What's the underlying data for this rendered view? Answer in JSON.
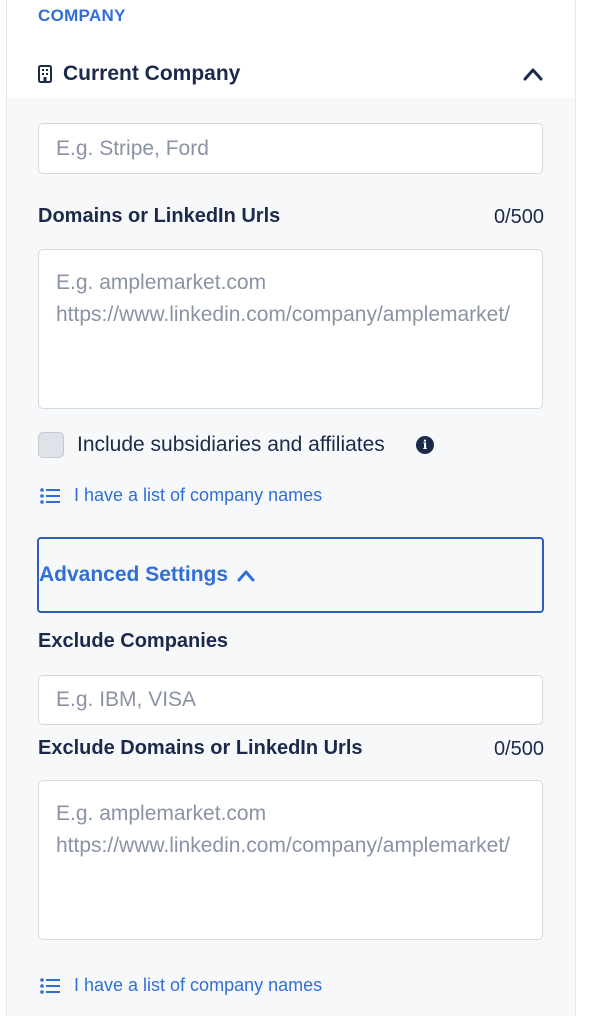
{
  "section": {
    "heading": "COMPANY"
  },
  "current_company": {
    "title": "Current Company",
    "icon": "building-icon",
    "collapse_icon": "chevron-up-icon",
    "input_placeholder": "E.g. Stripe, Ford"
  },
  "domains": {
    "label": "Domains or LinkedIn Urls",
    "counter": "0/500",
    "placeholder": "E.g. amplemarket.com\nhttps://www.linkedin.com/company/amplemarket/"
  },
  "subsidiaries": {
    "checked": false,
    "label": "Include subsidiaries and affiliates",
    "icon": "info-icon"
  },
  "list_link_1": {
    "label": "I have a list of company names",
    "icon": "list-icon"
  },
  "advanced": {
    "label": "Advanced Settings",
    "icon": "chevron-up-icon"
  },
  "exclude_companies": {
    "label": "Exclude Companies",
    "placeholder": "E.g. IBM, VISA"
  },
  "exclude_domains": {
    "label": "Exclude Domains or LinkedIn Urls",
    "counter": "0/500",
    "placeholder": "E.g. amplemarket.com\nhttps://www.linkedin.com/company/amplemarket/"
  },
  "list_link_2": {
    "label": "I have a list of company names",
    "icon": "list-icon"
  },
  "colors": {
    "accent": "#2f6fd6",
    "text": "#1b2a4a",
    "placeholder": "#8a93a3",
    "panel": "#f7f8fa"
  }
}
